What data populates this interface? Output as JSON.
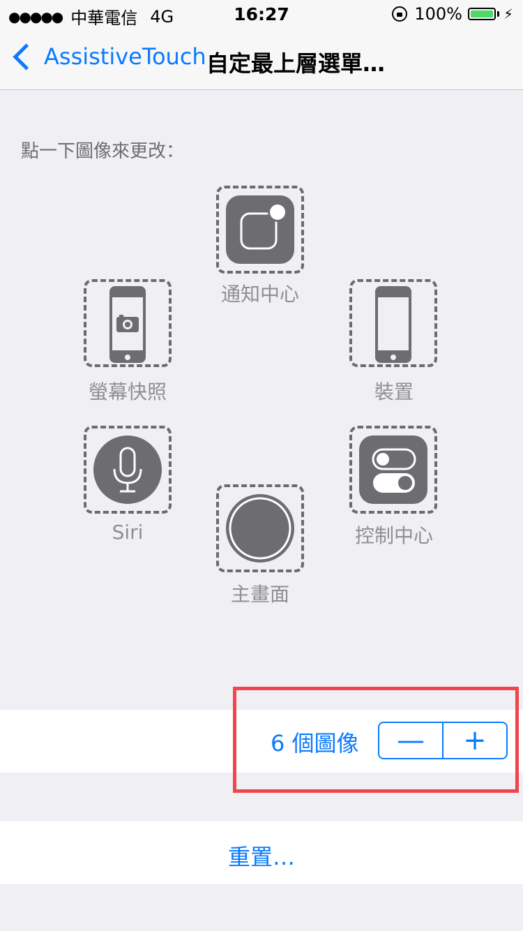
{
  "status": {
    "signal_dots": "●●●●●",
    "carrier": "中華電信",
    "network": "4G",
    "time": "16:27",
    "battery": "100%",
    "battery_level": 1.0,
    "battery_color": "#4cd964"
  },
  "nav": {
    "back_label": "AssistiveTouch",
    "title": "自定最上層選單…"
  },
  "instruction": "點一下圖像來更改：",
  "icons": {
    "notification": "通知中心",
    "screenshot": "螢幕快照",
    "device": "裝置",
    "siri": "Siri",
    "control": "控制中心",
    "home": "主畫面"
  },
  "count": {
    "label": "6 個圖像",
    "minus": "—",
    "plus": "+"
  },
  "reset_label": "重置…",
  "colors": {
    "accent": "#0a7aff",
    "highlight": "#f0454d",
    "icon": "#6d6c70"
  }
}
